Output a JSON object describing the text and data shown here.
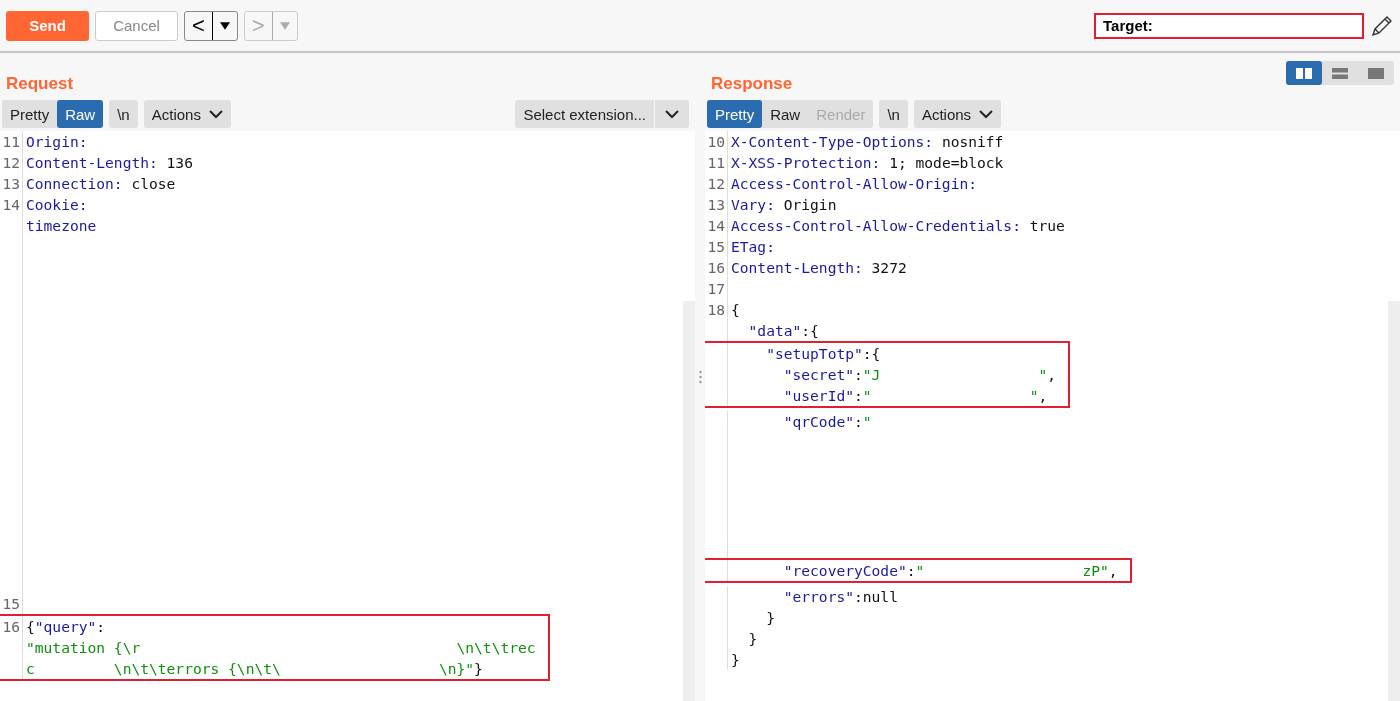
{
  "toolbar": {
    "send": "Send",
    "cancel": "Cancel",
    "back": {
      "label": "<",
      "disabled": false
    },
    "forward": {
      "label": ">",
      "disabled": true
    },
    "target_label": "Target:"
  },
  "layout_buttons": [
    {
      "kind": "columns",
      "selected": true
    },
    {
      "kind": "rows",
      "selected": false
    },
    {
      "kind": "single",
      "selected": false
    }
  ],
  "request": {
    "title": "Request",
    "view_tabs": [
      {
        "label": "Pretty",
        "selected": false,
        "disabled": false
      },
      {
        "label": "Raw",
        "selected": true,
        "disabled": false
      }
    ],
    "newline_button": "\\n",
    "actions": "Actions",
    "extension_select": "Select extension...",
    "blocks": [
      {
        "highlighted": false,
        "lines": [
          {
            "number": "11",
            "segments": [
              {
                "kind": "name",
                "text": "Origin:"
              }
            ]
          },
          {
            "number": "12",
            "segments": [
              {
                "kind": "name",
                "text": "Content-Length:"
              },
              {
                "kind": "text",
                "text": " 136"
              }
            ]
          },
          {
            "number": "13",
            "segments": [
              {
                "kind": "name",
                "text": "Connection:"
              },
              {
                "kind": "text",
                "text": " close"
              }
            ]
          },
          {
            "number": "14",
            "segments": [
              {
                "kind": "name",
                "text": "Cookie:"
              }
            ]
          },
          {
            "segments": [
              {
                "kind": "name",
                "text": "timezone"
              }
            ]
          },
          {
            "segments": [
              {
                "kind": "gap"
              }
            ]
          },
          {
            "segments": [
              {
                "kind": "gap"
              }
            ]
          },
          {
            "segments": [
              {
                "kind": "gap"
              }
            ]
          },
          {
            "segments": [
              {
                "kind": "gap"
              }
            ]
          },
          {
            "segments": [
              {
                "kind": "gap"
              }
            ]
          },
          {
            "segments": [
              {
                "kind": "gap"
              }
            ]
          },
          {
            "segments": [
              {
                "kind": "gap"
              }
            ]
          },
          {
            "segments": [
              {
                "kind": "gap"
              }
            ]
          },
          {
            "segments": [
              {
                "kind": "gap"
              }
            ]
          },
          {
            "segments": [
              {
                "kind": "gap"
              }
            ]
          },
          {
            "segments": [
              {
                "kind": "gap"
              }
            ]
          },
          {
            "segments": [
              {
                "kind": "gap"
              }
            ]
          },
          {
            "segments": [
              {
                "kind": "gap"
              }
            ]
          },
          {
            "segments": [
              {
                "kind": "gap"
              }
            ]
          },
          {
            "segments": [
              {
                "kind": "gap"
              }
            ]
          },
          {
            "segments": [
              {
                "kind": "gap"
              }
            ]
          },
          {
            "segments": [
              {
                "kind": "gap"
              }
            ]
          },
          {
            "number": "15",
            "segments": [
              {
                "kind": "gap"
              }
            ]
          }
        ]
      },
      {
        "highlighted": true,
        "lines": [
          {
            "number": "16",
            "segments": [
              {
                "kind": "text",
                "text": "{"
              },
              {
                "kind": "key",
                "text": "\"query\""
              },
              {
                "kind": "text",
                "text": ":"
              }
            ]
          },
          {
            "segments": [
              {
                "kind": "string",
                "text": "\"mutation {\\r"
              },
              {
                "kind": "gap"
              },
              {
                "kind": "gap"
              },
              {
                "kind": "gap"
              },
              {
                "kind": "gap"
              },
              {
                "kind": "string",
                "text": "\\n\\t\\trec"
              }
            ]
          },
          {
            "segments": [
              {
                "kind": "string",
                "text": "c"
              },
              {
                "kind": "gap"
              },
              {
                "kind": "string",
                "text": "\\n\\t\\terrors {\\n\\t\\"
              },
              {
                "kind": "gap"
              },
              {
                "kind": "gap"
              },
              {
                "kind": "string",
                "text": "\\n}\""
              },
              {
                "kind": "text",
                "text": "}"
              }
            ]
          }
        ]
      }
    ]
  },
  "response": {
    "title": "Response",
    "view_tabs": [
      {
        "label": "Pretty",
        "selected": true,
        "disabled": false
      },
      {
        "label": "Raw",
        "selected": false,
        "disabled": false
      },
      {
        "label": "Render",
        "selected": false,
        "disabled": true
      }
    ],
    "newline_button": "\\n",
    "actions": "Actions",
    "blocks": [
      {
        "highlighted": false,
        "lines": [
          {
            "number": "10",
            "segments": [
              {
                "kind": "name",
                "text": "X-Content-Type-Options:"
              },
              {
                "kind": "text",
                "text": " nosniff"
              }
            ]
          },
          {
            "number": "11",
            "segments": [
              {
                "kind": "name",
                "text": "X-XSS-Protection:"
              },
              {
                "kind": "text",
                "text": " 1; mode=block"
              }
            ]
          },
          {
            "number": "12",
            "segments": [
              {
                "kind": "name",
                "text": "Access-Control-Allow-Origin:"
              }
            ]
          },
          {
            "number": "13",
            "segments": [
              {
                "kind": "name",
                "text": "Vary:"
              },
              {
                "kind": "text",
                "text": " Origin"
              }
            ]
          },
          {
            "number": "14",
            "segments": [
              {
                "kind": "name",
                "text": "Access-Control-Allow-Credentials:"
              },
              {
                "kind": "text",
                "text": " true"
              }
            ]
          },
          {
            "number": "15",
            "segments": [
              {
                "kind": "name",
                "text": "ETag:"
              }
            ]
          },
          {
            "number": "16",
            "segments": [
              {
                "kind": "name",
                "text": "Content-Length:"
              },
              {
                "kind": "text",
                "text": " 3272"
              }
            ]
          },
          {
            "number": "17",
            "segments": [
              {
                "kind": "gap"
              }
            ]
          },
          {
            "number": "18",
            "segments": [
              {
                "kind": "text",
                "text": "{"
              }
            ]
          },
          {
            "segments": [
              {
                "kind": "key",
                "text": "  \"data\""
              },
              {
                "kind": "text",
                "text": ":{"
              }
            ]
          }
        ]
      },
      {
        "highlighted": true,
        "lines": [
          {
            "segments": [
              {
                "kind": "key",
                "text": "    \"setupTotp\""
              },
              {
                "kind": "text",
                "text": ":{"
              }
            ]
          },
          {
            "segments": [
              {
                "kind": "key",
                "text": "      \"secret\""
              },
              {
                "kind": "text",
                "text": ":"
              },
              {
                "kind": "string",
                "text": "\"J"
              },
              {
                "kind": "gap"
              },
              {
                "kind": "gap"
              },
              {
                "kind": "string",
                "text": "\""
              },
              {
                "kind": "text",
                "text": ","
              }
            ]
          },
          {
            "segments": [
              {
                "kind": "key",
                "text": "      \"userId\""
              },
              {
                "kind": "text",
                "text": ":"
              },
              {
                "kind": "string",
                "text": "\""
              },
              {
                "kind": "gap"
              },
              {
                "kind": "gap"
              },
              {
                "kind": "string",
                "text": "\""
              },
              {
                "kind": "text",
                "text": ","
              }
            ]
          }
        ]
      },
      {
        "highlighted": false,
        "lines": [
          {
            "segments": [
              {
                "kind": "key",
                "text": "      \"qrCode\""
              },
              {
                "kind": "text",
                "text": ":"
              },
              {
                "kind": "string",
                "text": "\""
              }
            ]
          },
          {
            "segments": [
              {
                "kind": "gap"
              }
            ]
          },
          {
            "segments": [
              {
                "kind": "gap"
              }
            ]
          },
          {
            "segments": [
              {
                "kind": "gap"
              }
            ]
          },
          {
            "segments": [
              {
                "kind": "gap"
              }
            ]
          },
          {
            "segments": [
              {
                "kind": "gap"
              }
            ]
          },
          {
            "segments": [
              {
                "kind": "gap"
              }
            ]
          }
        ]
      },
      {
        "highlighted": true,
        "lines": [
          {
            "segments": [
              {
                "kind": "key",
                "text": "      \"recoveryCode\""
              },
              {
                "kind": "text",
                "text": ":"
              },
              {
                "kind": "string",
                "text": "\""
              },
              {
                "kind": "gap"
              },
              {
                "kind": "gap"
              },
              {
                "kind": "string",
                "text": "zP\""
              },
              {
                "kind": "text",
                "text": ","
              }
            ]
          }
        ]
      },
      {
        "highlighted": false,
        "lines": [
          {
            "segments": [
              {
                "kind": "key",
                "text": "      \"errors\""
              },
              {
                "kind": "text",
                "text": ":null"
              }
            ]
          },
          {
            "segments": [
              {
                "kind": "text",
                "text": "    }"
              }
            ]
          },
          {
            "segments": [
              {
                "kind": "text",
                "text": "  }"
              }
            ]
          },
          {
            "segments": [
              {
                "kind": "text",
                "text": "}"
              }
            ]
          }
        ]
      }
    ]
  }
}
